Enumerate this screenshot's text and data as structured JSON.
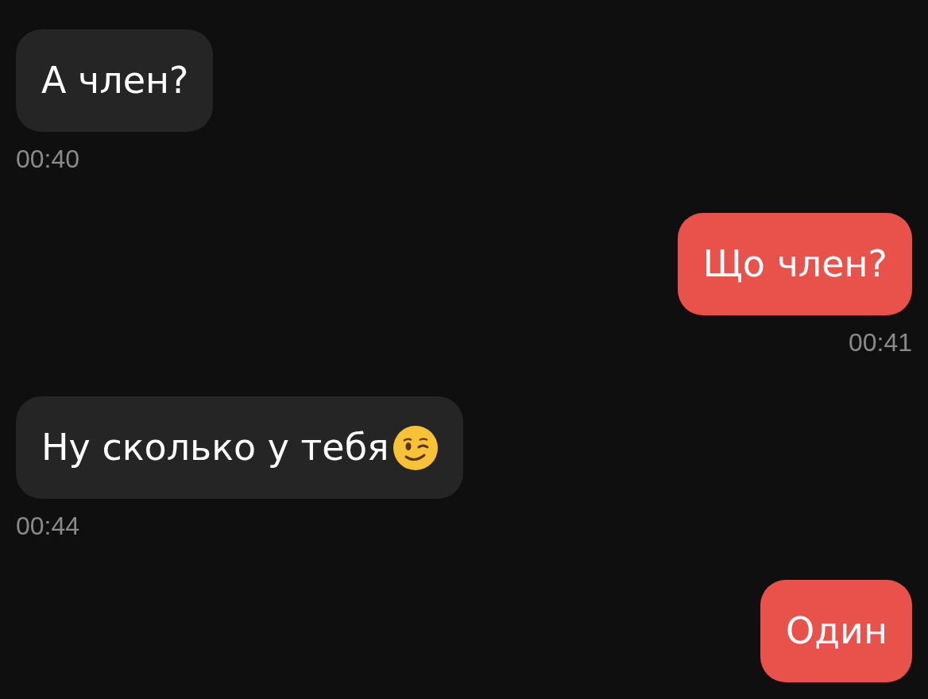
{
  "messages": [
    {
      "kind": "incoming",
      "text": "А член?",
      "time": "00:40"
    },
    {
      "kind": "outgoing",
      "text": "Що член?",
      "time": "00:41"
    },
    {
      "kind": "incoming",
      "text": "Ну сколько у тебя",
      "wink_emoji": true,
      "time": "00:44"
    },
    {
      "kind": "outgoing",
      "text": "Один"
    }
  ]
}
